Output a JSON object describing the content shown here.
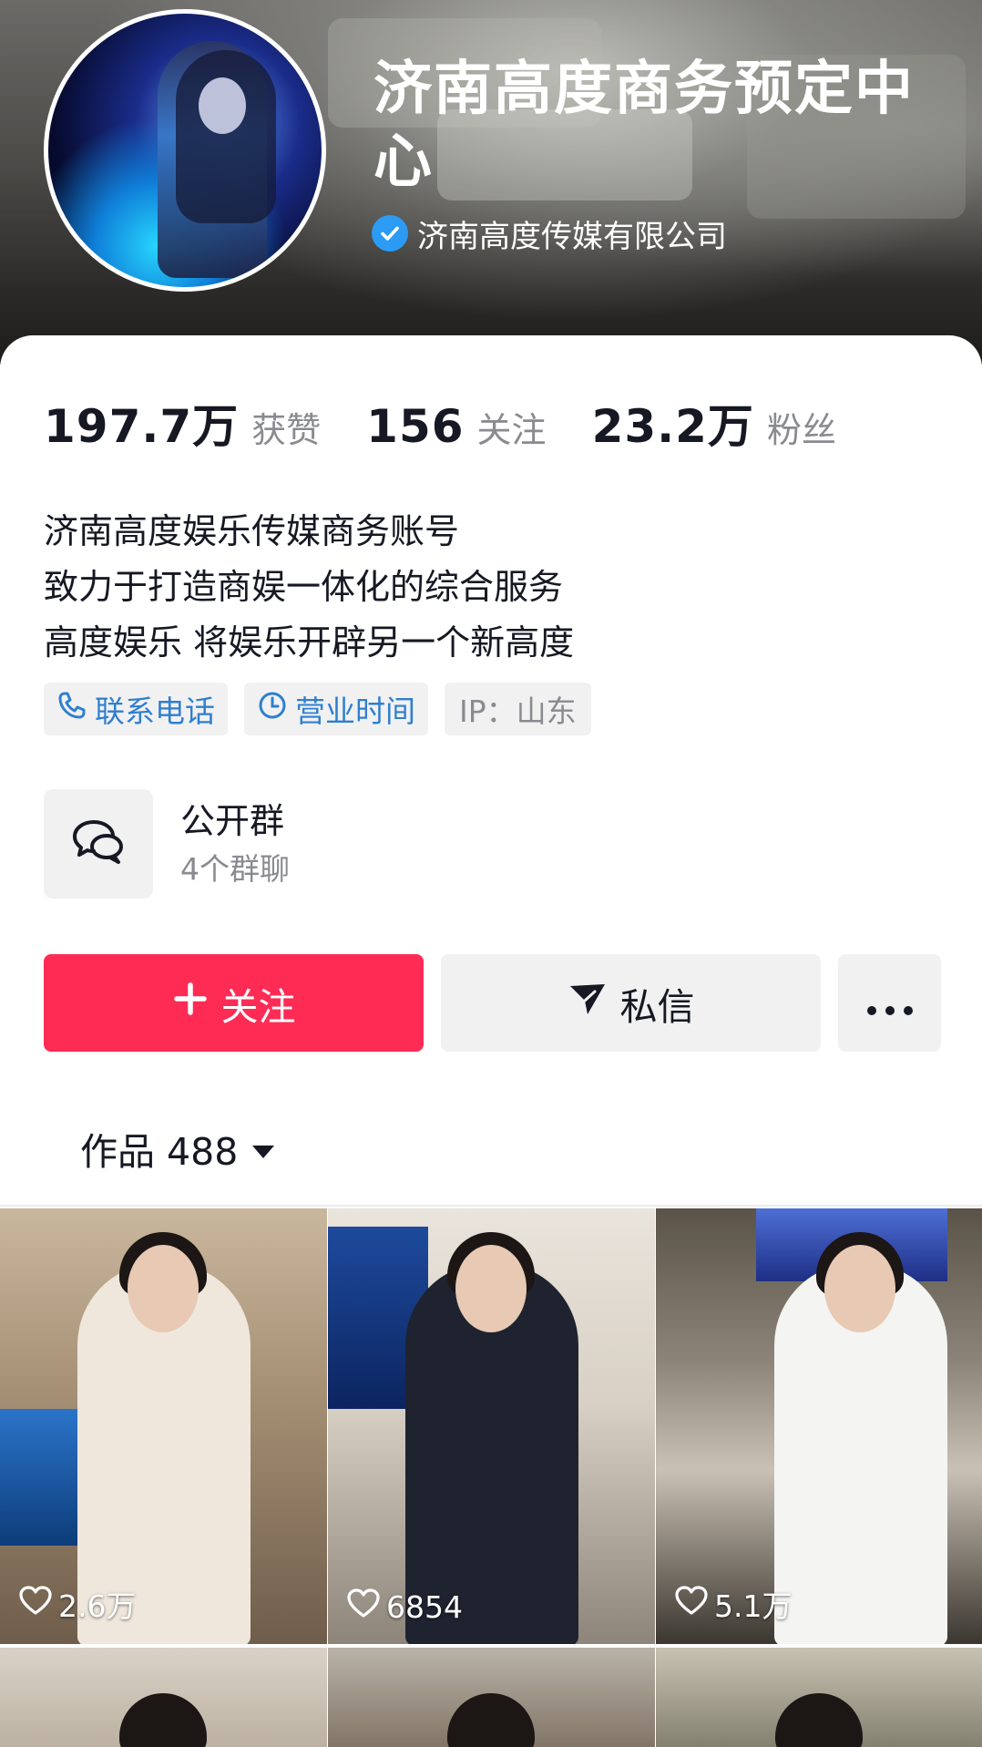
{
  "profile": {
    "name": "济南高度商务预定中心",
    "verified_org": "济南高度传媒有限公司"
  },
  "stats": [
    {
      "value": "197.7万",
      "label": "获赞"
    },
    {
      "value": "156",
      "label": "关注"
    },
    {
      "value": "23.2万",
      "label": "粉丝"
    }
  ],
  "bio": {
    "lines": [
      "济南高度娱乐传媒商务账号",
      "致力于打造商娱一体化的综合服务",
      "高度娱乐 将娱乐开辟另一个新高度"
    ]
  },
  "tags": {
    "phone": "联系电话",
    "hours": "营业时间",
    "ip": "IP：山东"
  },
  "group": {
    "title": "公开群",
    "subtitle": "4个群聊"
  },
  "actions": {
    "follow": "关注",
    "message": "私信"
  },
  "works": {
    "label": "作品 488"
  },
  "videos": [
    {
      "likes": "2.6万"
    },
    {
      "likes": "6854"
    },
    {
      "likes": "5.1万"
    }
  ],
  "colors": {
    "accent": "#fe2c55",
    "link_blue": "#2f7fd0",
    "verify_blue": "#2b9bf5",
    "muted_text": "#8a8b91",
    "chip_bg": "#f1f1f2"
  },
  "icons": {
    "verified": "verified-check-icon",
    "phone": "phone-icon",
    "clock": "clock-icon",
    "group": "chat-bubbles-icon",
    "follow": "plus-icon",
    "message": "send-plane-icon",
    "more": "more-dots-icon",
    "dropdown": "triangle-down-icon",
    "like": "heart-outline-icon"
  }
}
